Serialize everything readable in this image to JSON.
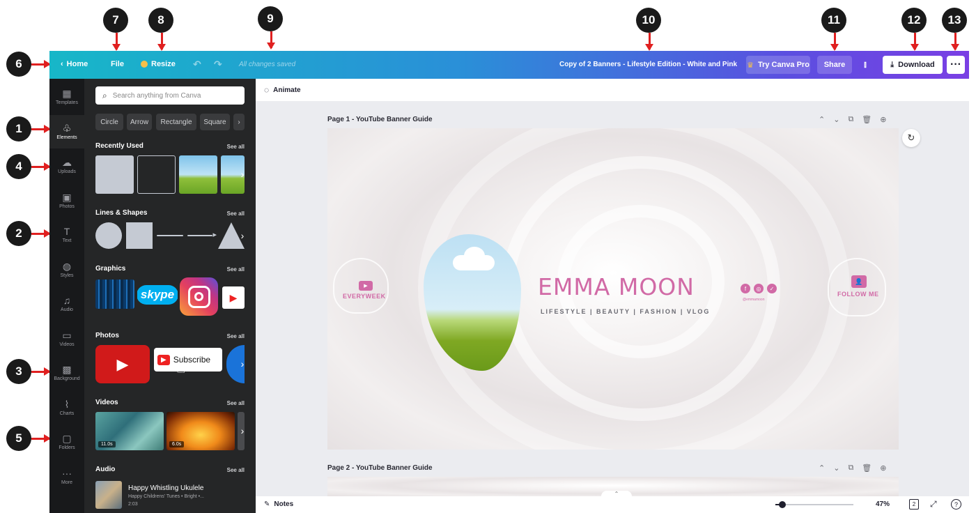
{
  "callouts": [
    "1",
    "2",
    "3",
    "4",
    "5",
    "6",
    "7",
    "8",
    "9",
    "10",
    "11",
    "12",
    "13"
  ],
  "topbar": {
    "home": "Home",
    "file": "File",
    "resize": "Resize",
    "saved_status": "All changes saved",
    "doc_title": "Copy of 2 Banners - Lifestyle Edition - White and Pink",
    "try_pro": "Try Canva Pro",
    "share": "Share",
    "download": "Download",
    "more": "···"
  },
  "rail": [
    {
      "label": "Templates",
      "icon": "templates-icon",
      "glyph": "▦"
    },
    {
      "label": "Elements",
      "icon": "elements-icon",
      "glyph": "♧"
    },
    {
      "label": "Uploads",
      "icon": "uploads-icon",
      "glyph": "☁"
    },
    {
      "label": "Photos",
      "icon": "photos-icon",
      "glyph": "▣"
    },
    {
      "label": "Text",
      "icon": "text-icon",
      "glyph": "T"
    },
    {
      "label": "Styles",
      "icon": "styles-icon",
      "glyph": "◍"
    },
    {
      "label": "Audio",
      "icon": "audio-icon",
      "glyph": "♫"
    },
    {
      "label": "Videos",
      "icon": "videos-icon",
      "glyph": "▭"
    },
    {
      "label": "Background",
      "icon": "background-icon",
      "glyph": "▩"
    },
    {
      "label": "Charts",
      "icon": "charts-icon",
      "glyph": "⌇"
    },
    {
      "label": "Folders",
      "icon": "folders-icon",
      "glyph": "▢"
    },
    {
      "label": "More",
      "icon": "more-icon",
      "glyph": "···"
    }
  ],
  "panel": {
    "search_placeholder": "Search anything from Canva",
    "chips": [
      "Circle",
      "Arrow",
      "Rectangle",
      "Square"
    ],
    "see_all": "See all",
    "sections": {
      "recently_used": "Recently Used",
      "lines_shapes": "Lines & Shapes",
      "graphics": "Graphics",
      "photos": "Photos",
      "videos": "Videos",
      "audio": "Audio"
    },
    "skype_text": "skype",
    "subscribe_text": "Subscribe",
    "video_durations": [
      "11.0s",
      "6.0s"
    ],
    "audio_track": {
      "title": "Happy Whistling Ukulele",
      "subtitle": "Happy Childrens' Tunes • Bright •...",
      "duration": "2:03"
    }
  },
  "canvas": {
    "animate": "Animate",
    "page1_title": "Page 1 - YouTube Banner Guide",
    "page2_title": "Page 2 - YouTube Banner Guide",
    "banner": {
      "name": "EMMA MOON",
      "tagline": "LIFESTYLE | BEAUTY | FASHION | VLOG",
      "everyweek": "EVERYWEEK",
      "follow_me": "FOLLOW ME",
      "handle": "@emmamoon"
    },
    "notes": "Notes",
    "zoom": "47%",
    "page_count": "2",
    "zoom_level": 0.09
  }
}
